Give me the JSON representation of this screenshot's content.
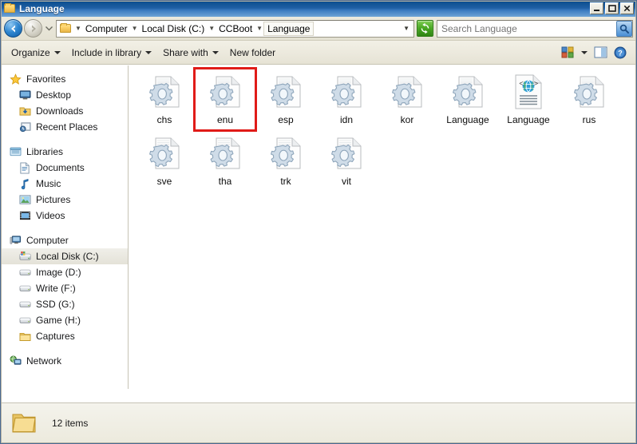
{
  "window": {
    "title": "Language",
    "title_icon": "folder-icon",
    "controls": [
      {
        "name": "minimize-button",
        "label": "_"
      },
      {
        "name": "maximize-button",
        "label": "□"
      },
      {
        "name": "close-button",
        "label": "✕"
      }
    ]
  },
  "address_bar": {
    "back_button": "back-arrow-icon",
    "forward_button": "forward-arrow-icon",
    "history_dropdown": "chevron-down-icon",
    "crumb_folder_icon": "folder-icon",
    "breadcrumbs": [
      "Computer",
      "Local Disk (C:)",
      "CCBoot",
      "Language"
    ],
    "refresh_button": "refresh-icon",
    "search": {
      "value": "",
      "placeholder": "Search Language",
      "icon": "search-icon"
    }
  },
  "toolbar": {
    "items": [
      {
        "label": "Organize",
        "has_caret": true
      },
      {
        "label": "Include in library",
        "has_caret": true
      },
      {
        "label": "Share with",
        "has_caret": true
      },
      {
        "label": "New folder",
        "has_caret": false
      }
    ],
    "right_items": [
      {
        "name": "change-view-button",
        "icon": "view-icons-icon"
      },
      {
        "name": "change-view-dropdown",
        "icon": "caret-down-icon"
      },
      {
        "name": "preview-pane-button",
        "icon": "preview-pane-icon"
      },
      {
        "name": "help-button",
        "icon": "help-icon"
      }
    ]
  },
  "sidebar": {
    "groups": [
      {
        "root": {
          "label": "Favorites",
          "icon": "star-icon"
        },
        "items": [
          {
            "label": "Desktop",
            "icon": "desktop-icon",
            "selected": false
          },
          {
            "label": "Downloads",
            "icon": "downloads-icon",
            "selected": false
          },
          {
            "label": "Recent Places",
            "icon": "recent-places-icon",
            "selected": false
          }
        ]
      },
      {
        "root": {
          "label": "Libraries",
          "icon": "libraries-icon"
        },
        "items": [
          {
            "label": "Documents",
            "icon": "documents-icon",
            "selected": false
          },
          {
            "label": "Music",
            "icon": "music-icon",
            "selected": false
          },
          {
            "label": "Pictures",
            "icon": "pictures-icon",
            "selected": false
          },
          {
            "label": "Videos",
            "icon": "videos-icon",
            "selected": false
          }
        ]
      },
      {
        "root": {
          "label": "Computer",
          "icon": "computer-icon"
        },
        "items": [
          {
            "label": "Local Disk (C:)",
            "icon": "system-drive-icon",
            "selected": true
          },
          {
            "label": "Image (D:)",
            "icon": "drive-icon",
            "selected": false
          },
          {
            "label": "Write (F:)",
            "icon": "drive-icon",
            "selected": false
          },
          {
            "label": "SSD (G:)",
            "icon": "drive-icon",
            "selected": false
          },
          {
            "label": "Game (H:)",
            "icon": "drive-icon",
            "selected": false
          },
          {
            "label": "Captures",
            "icon": "folder-icon",
            "selected": false
          }
        ]
      },
      {
        "root": {
          "label": "Network",
          "icon": "network-icon"
        },
        "items": []
      }
    ]
  },
  "files": [
    {
      "name": "chs",
      "icon": "config-file-icon",
      "highlighted": false
    },
    {
      "name": "enu",
      "icon": "config-file-icon",
      "highlighted": true
    },
    {
      "name": "esp",
      "icon": "config-file-icon",
      "highlighted": false
    },
    {
      "name": "idn",
      "icon": "config-file-icon",
      "highlighted": false
    },
    {
      "name": "kor",
      "icon": "config-file-icon",
      "highlighted": false
    },
    {
      "name": "Language",
      "icon": "config-file-icon",
      "highlighted": false
    },
    {
      "name": "Language",
      "icon": "html-file-icon",
      "highlighted": false
    },
    {
      "name": "rus",
      "icon": "config-file-icon",
      "highlighted": false
    },
    {
      "name": "sve",
      "icon": "config-file-icon",
      "highlighted": false
    },
    {
      "name": "tha",
      "icon": "config-file-icon",
      "highlighted": false
    },
    {
      "name": "trk",
      "icon": "config-file-icon",
      "highlighted": false
    },
    {
      "name": "vit",
      "icon": "config-file-icon",
      "highlighted": false
    }
  ],
  "status_bar": {
    "icon": "folder-icon",
    "text": "12 items"
  },
  "colors": {
    "titlebar_blue": "#1f5fa4",
    "highlight_red": "#e01b18",
    "chrome": "#e4e1d2",
    "content_white": "#ffffff",
    "refresh_green": "#47a621"
  }
}
